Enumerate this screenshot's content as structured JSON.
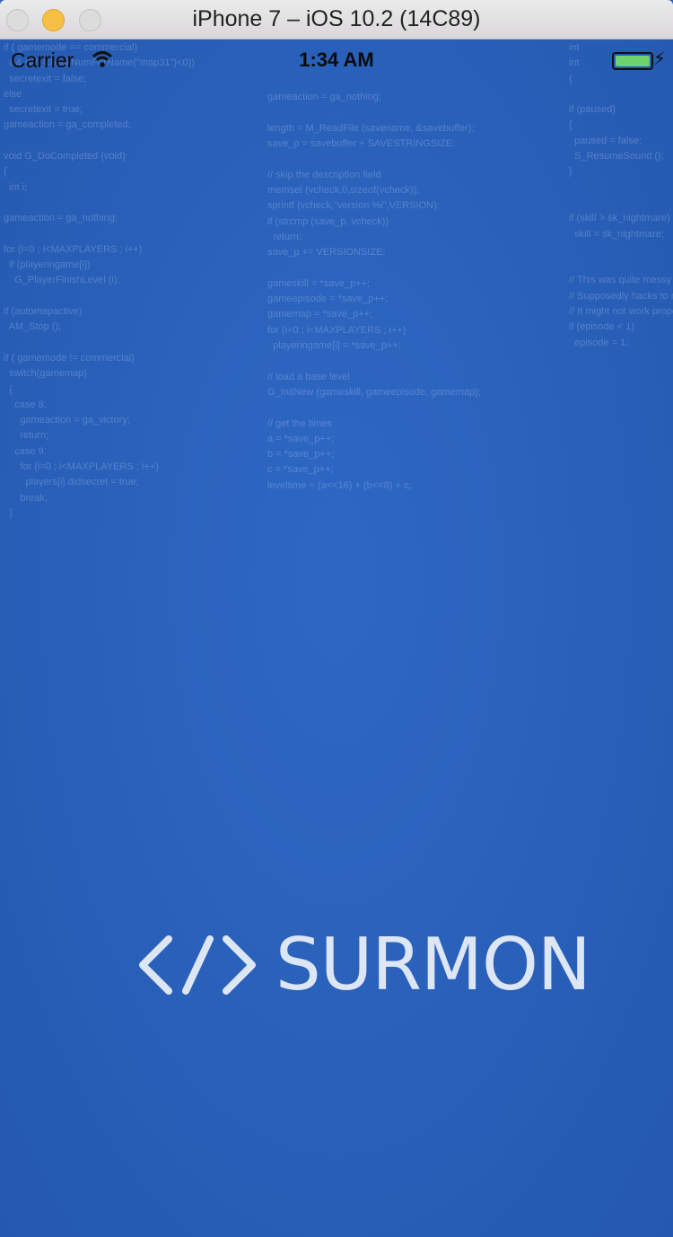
{
  "window": {
    "title": "iPhone 7 – iOS 10.2 (14C89)"
  },
  "status_bar": {
    "carrier": "Carrier",
    "time": "1:34 AM",
    "battery_level": 1.0,
    "charging": true
  },
  "splash": {
    "logo_text": "SURMON",
    "logo_mark": "</>"
  },
  "background_code": {
    "left": [
      "if ( gamemode == commercial)",
      "  && (W_CheckNumForName(\"map31\")<0))",
      "  secretexit = false;",
      "else",
      "  secretexit = true;",
      "gameaction = ga_completed;",
      "",
      "void G_DoCompleted (void)",
      "{",
      "  int i;",
      "",
      "gameaction = ga_nothing;",
      "",
      "for (i=0 ; i<MAXPLAYERS ; i++)",
      "  if (playeringame[i])",
      "    G_PlayerFinishLevel (i);",
      "",
      "if (automapactive)",
      "  AM_Stop ();",
      "",
      "if ( gamemode != commercial)",
      "  switch(gamemap)",
      "  {",
      "    case 8:",
      "      gameaction = ga_victory;",
      "      return;",
      "    case 9:",
      "      for (i=0 ; i<MAXPLAYERS ; i++)",
      "        players[i].didsecret = true;",
      "      break;",
      "  }"
    ],
    "middle": [
      "",
      "gameaction = ga_nothing;",
      "",
      "length = M_ReadFile (savename, &savebuffer);",
      "save_p = savebuffer + SAVESTRINGSIZE;",
      "",
      "// skip the description field",
      "memset (vcheck,0,sizeof(vcheck));",
      "sprintf (vcheck,\"version %i\",VERSION);",
      "if (strcmp (save_p, vcheck))",
      "  return;",
      "save_p += VERSIONSIZE;",
      "",
      "gameskill = *save_p++;",
      "gameepisode = *save_p++;",
      "gamemap = *save_p++;",
      "for (i=0 ; i<MAXPLAYERS ; i++)",
      "  playeringame[i] = *save_p++;",
      "",
      "// load a base level",
      "G_InitNew (gameskill, gameepisode, gamemap);",
      "",
      "// get the times",
      "a = *save_p++;",
      "b = *save_p++;",
      "c = *save_p++;",
      "leveltime = (a<<16) + (b<<8) + c;"
    ],
    "right": [
      "int",
      "int",
      "{",
      "",
      "if (paused)",
      "{",
      "  paused = false;",
      "  S_ResumeSound ();",
      "}",
      "",
      "",
      "if (skill > sk_nightmare)",
      "  skill = sk_nightmare;",
      "",
      "",
      "// This was quite messy",
      "// Supposedly hacks to make",
      "// It might not work prope",
      "if (episode < 1)",
      "  episode = 1;"
    ]
  }
}
